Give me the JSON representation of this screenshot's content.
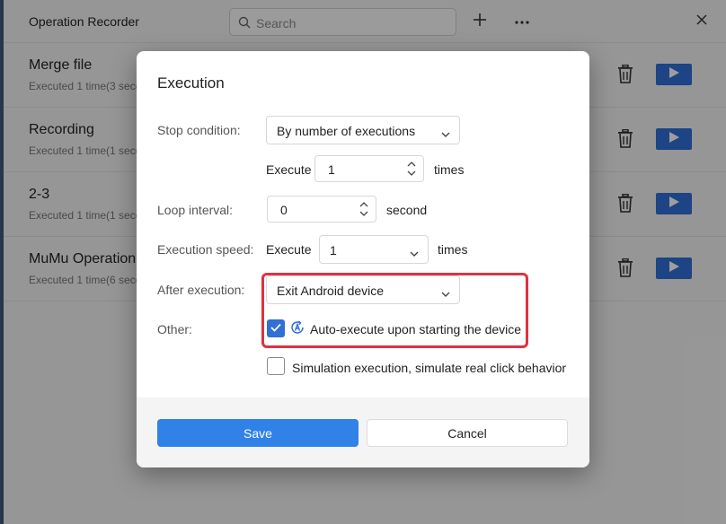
{
  "app": {
    "title": "Operation Recorder"
  },
  "search": {
    "placeholder": "Search"
  },
  "toolbar": {
    "add_icon": "plus-icon",
    "more_icon": "more-horizontal-icon",
    "close_icon": "close-icon"
  },
  "recordings": [
    {
      "name": "Merge file",
      "meta": "Executed 1 time(3 seco"
    },
    {
      "name": "Recording",
      "meta": "Executed 1 time(1 seco"
    },
    {
      "name": "2-3",
      "meta": "Executed 1 time(1 seco"
    },
    {
      "name": "MuMu Operation",
      "meta": "Executed 1 time(6 seco"
    }
  ],
  "dialog": {
    "title": "Execution",
    "stop_condition": {
      "label": "Stop condition:",
      "value": "By number of executions"
    },
    "execute_count": {
      "prefix": "Execute",
      "value": "1",
      "suffix": "times"
    },
    "loop_interval": {
      "label": "Loop interval:",
      "value": "0",
      "suffix": "second"
    },
    "execution_speed": {
      "label": "Execution speed:",
      "prefix": "Execute",
      "value": "1",
      "suffix": "times"
    },
    "after_execution": {
      "label": "After execution:",
      "value": "Exit Android device"
    },
    "other": {
      "label": "Other:",
      "auto_execute": {
        "label": "Auto-execute upon starting the device",
        "checked": true
      },
      "simulation": {
        "label": "Simulation execution, simulate real click behavior",
        "checked": false
      }
    },
    "save_label": "Save",
    "cancel_label": "Cancel"
  },
  "colors": {
    "accent": "#3182e8",
    "play_button": "#2f6fd6",
    "highlight": "#e0313f"
  }
}
